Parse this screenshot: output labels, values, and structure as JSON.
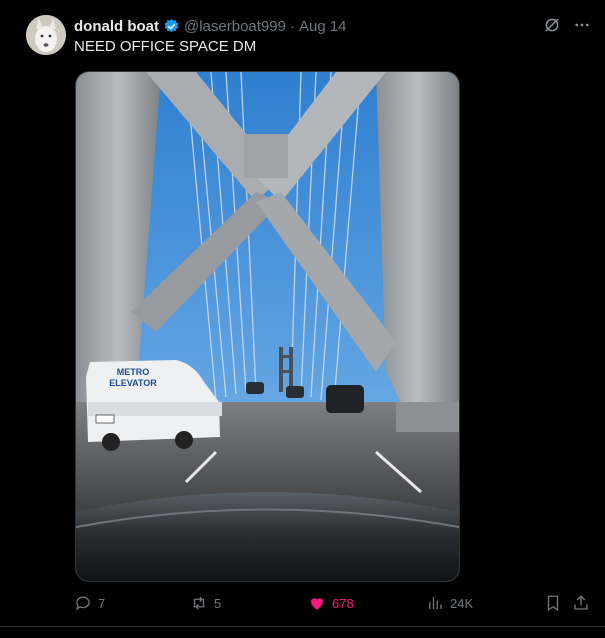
{
  "tweet": {
    "author_name": "donald boat",
    "handle": "@laserboat999",
    "separator": "·",
    "date": "Aug 14",
    "text": "NEED OFFICE SPACE DM",
    "van_text_line1": "METRO",
    "van_text_line2": "ELEVATOR"
  },
  "actions": {
    "replies": "7",
    "reposts": "5",
    "likes": "678",
    "views": "24K"
  },
  "colors": {
    "background": "#000000",
    "text": "#e7e9ea",
    "muted": "#71767b",
    "verified": "#1d9bf0",
    "like": "#f91880"
  },
  "icons": [
    "grok-icon",
    "more-icon",
    "verified-badge-icon",
    "reply-icon",
    "repost-icon",
    "like-icon",
    "views-icon",
    "bookmark-icon",
    "share-icon"
  ]
}
